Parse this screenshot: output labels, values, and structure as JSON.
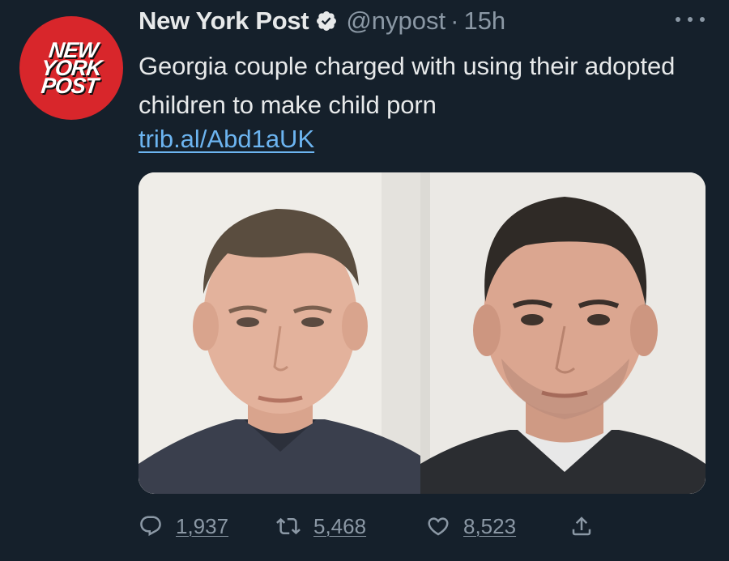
{
  "author": {
    "display_name": "New York Post",
    "handle": "@nypost",
    "separator": "·",
    "time": "15h",
    "avatar_lines": [
      "NEW",
      "YORK",
      "POST"
    ],
    "verified": true
  },
  "tweet": {
    "text": "Georgia couple charged with using their adopted children to make child porn",
    "link": "trib.al/Abd1aUK"
  },
  "media": {
    "count": 2,
    "items": [
      {
        "kind": "photo",
        "icon": "person-photo"
      },
      {
        "kind": "photo",
        "icon": "person-photo"
      }
    ]
  },
  "actions": {
    "reply_count": "1,937",
    "retweet_count": "5,468",
    "like_count": "8,523"
  },
  "colors": {
    "background": "#15202b",
    "text": "#e7e9ea",
    "muted": "#8b98a5",
    "link": "#6cb4f0",
    "brand": "#d8262b"
  }
}
